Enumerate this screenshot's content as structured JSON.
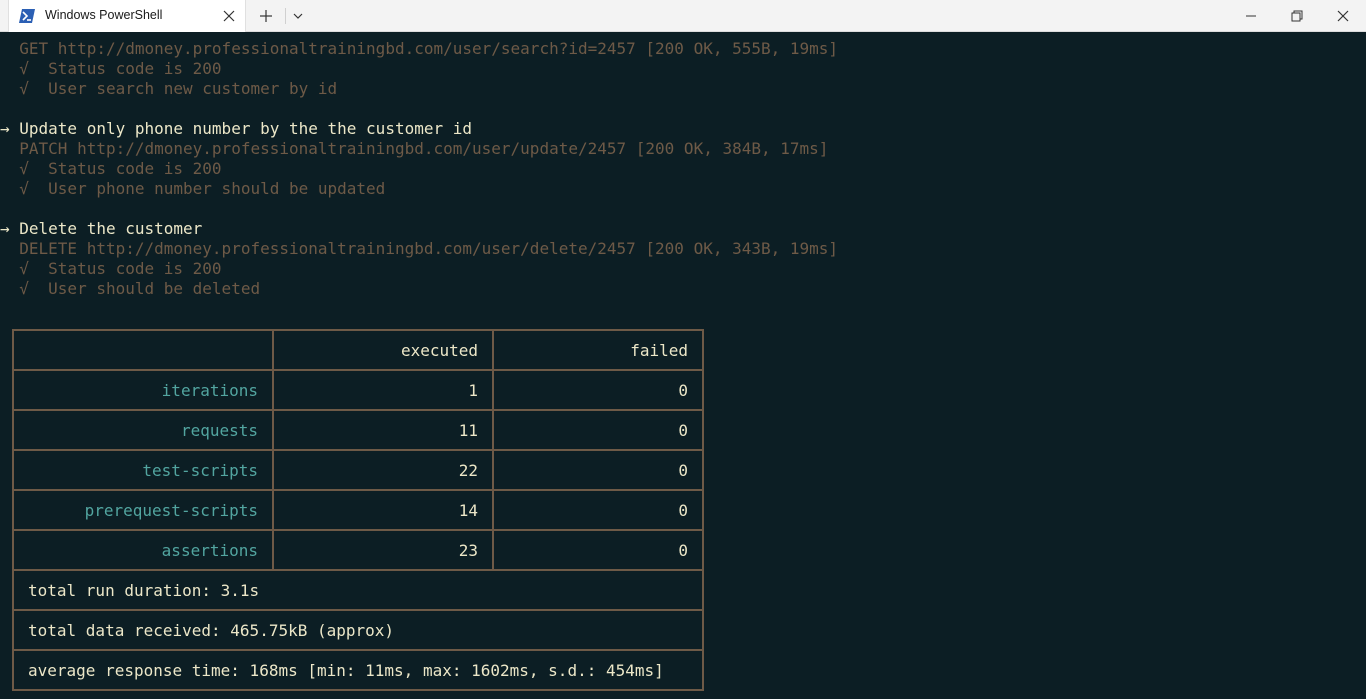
{
  "window": {
    "tab_title": "Windows PowerShell"
  },
  "terminal": {
    "lines": [
      {
        "text": "  GET http://dmoney.professionaltrainingbd.com/user/search?id=2457 [200 OK, 555B, 19ms]",
        "style": "dim"
      },
      {
        "text": "  √  Status code is 200",
        "style": "dim"
      },
      {
        "text": "  √  User search new customer by id",
        "style": "dim"
      },
      {
        "text": "",
        "style": "dim"
      },
      {
        "text": "→ Update only phone number by the the customer id",
        "style": "bright"
      },
      {
        "text": "  PATCH http://dmoney.professionaltrainingbd.com/user/update/2457 [200 OK, 384B, 17ms]",
        "style": "dim"
      },
      {
        "text": "  √  Status code is 200",
        "style": "dim"
      },
      {
        "text": "  √  User phone number should be updated",
        "style": "dim"
      },
      {
        "text": "",
        "style": "dim"
      },
      {
        "text": "→ Delete the customer",
        "style": "bright"
      },
      {
        "text": "  DELETE http://dmoney.professionaltrainingbd.com/user/delete/2457 [200 OK, 343B, 19ms]",
        "style": "dim"
      },
      {
        "text": "  √  Status code is 200",
        "style": "dim"
      },
      {
        "text": "  √  User should be deleted",
        "style": "dim"
      }
    ]
  },
  "summary": {
    "headers": [
      "",
      "executed",
      "failed"
    ],
    "rows": [
      {
        "label": "iterations",
        "executed": "1",
        "failed": "0"
      },
      {
        "label": "requests",
        "executed": "11",
        "failed": "0"
      },
      {
        "label": "test-scripts",
        "executed": "22",
        "failed": "0"
      },
      {
        "label": "prerequest-scripts",
        "executed": "14",
        "failed": "0"
      },
      {
        "label": "assertions",
        "executed": "23",
        "failed": "0"
      }
    ],
    "total_run_duration": "total run duration: 3.1s",
    "total_data_received": "total data received: 465.75kB (approx)",
    "average_response_time": "average response time: 168ms [min: 11ms, max: 1602ms, s.d.: 454ms]"
  },
  "colors": {
    "background": "#0c1e24",
    "dim_text": "#6e5a47",
    "bright_text": "#ece7c8",
    "label_text": "#52a5a0"
  }
}
